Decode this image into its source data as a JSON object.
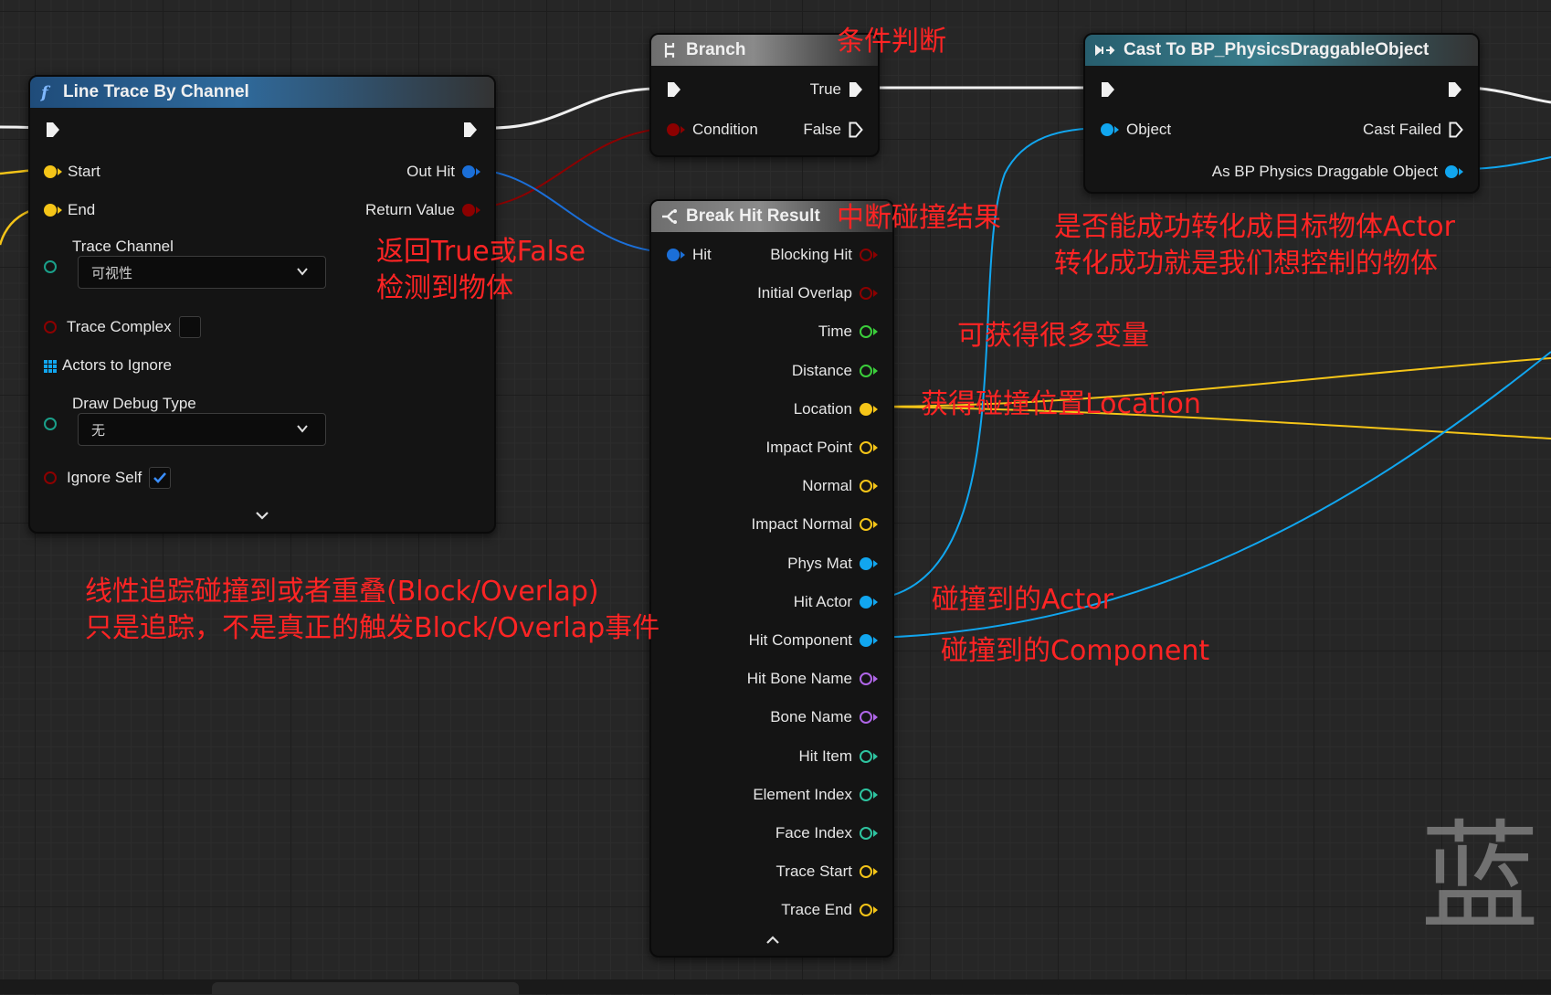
{
  "colors": {
    "exec": "#f0f0f0",
    "bool": "#8c0000",
    "struct": "#1b6fd8",
    "vector": "#f5c518",
    "float": "#3bcf3b",
    "name": "#b066e8",
    "int": "#2ec4a0",
    "object": "#11a6ef",
    "annotation": "#ff2424"
  },
  "line_trace": {
    "title": "Line Trace By Channel",
    "icon": "function-icon",
    "start_label": "Start",
    "end_label": "End",
    "trace_channel_label": "Trace Channel",
    "trace_channel_value": "可视性",
    "trace_complex_label": "Trace Complex",
    "trace_complex_checked": false,
    "actors_to_ignore_label": "Actors to Ignore",
    "draw_debug_label": "Draw Debug Type",
    "draw_debug_value": "无",
    "ignore_self_label": "Ignore Self",
    "ignore_self_checked": true,
    "out_hit_label": "Out Hit",
    "return_value_label": "Return Value"
  },
  "branch": {
    "title": "Branch",
    "true_label": "True",
    "condition_label": "Condition",
    "false_label": "False"
  },
  "cast": {
    "title": "Cast To BP_PhysicsDraggableObject",
    "object_label": "Object",
    "cast_failed_label": "Cast Failed",
    "as_label": "As BP Physics Draggable Object"
  },
  "break_hit": {
    "title": "Break Hit Result",
    "hit_label": "Hit",
    "outputs": [
      {
        "label": "Blocking Hit",
        "type": "bool"
      },
      {
        "label": "Initial Overlap",
        "type": "bool"
      },
      {
        "label": "Time",
        "type": "float"
      },
      {
        "label": "Distance",
        "type": "float"
      },
      {
        "label": "Location",
        "type": "vector"
      },
      {
        "label": "Impact Point",
        "type": "vector"
      },
      {
        "label": "Normal",
        "type": "vector"
      },
      {
        "label": "Impact Normal",
        "type": "vector"
      },
      {
        "label": "Phys Mat",
        "type": "object"
      },
      {
        "label": "Hit Actor",
        "type": "object"
      },
      {
        "label": "Hit Component",
        "type": "object"
      },
      {
        "label": "Hit Bone Name",
        "type": "name"
      },
      {
        "label": "Bone Name",
        "type": "name"
      },
      {
        "label": "Hit Item",
        "type": "int"
      },
      {
        "label": "Element Index",
        "type": "int"
      },
      {
        "label": "Face Index",
        "type": "int"
      },
      {
        "label": "Trace Start",
        "type": "vector"
      },
      {
        "label": "Trace End",
        "type": "vector"
      }
    ]
  },
  "annotations": {
    "branch_note": "条件判断",
    "break_note": "中断碰撞结果",
    "return_note_1": "返回True或False",
    "return_note_2": "检测到物体",
    "cast_note_1": "是否能成功转化成目标物体Actor",
    "cast_note_2": "转化成功就是我们想控制的物体",
    "vars_note": "可获得很多变量",
    "location_note": "获得碰撞位置Location",
    "trace_note_1": "线性追踪碰撞到或者重叠(Block/Overlap)",
    "trace_note_2": "只是追踪，不是真正的触发Block/Overlap事件",
    "hit_actor_note": "碰撞到的Actor",
    "hit_component_note": "碰撞到的Component"
  },
  "watermark": "蓝"
}
